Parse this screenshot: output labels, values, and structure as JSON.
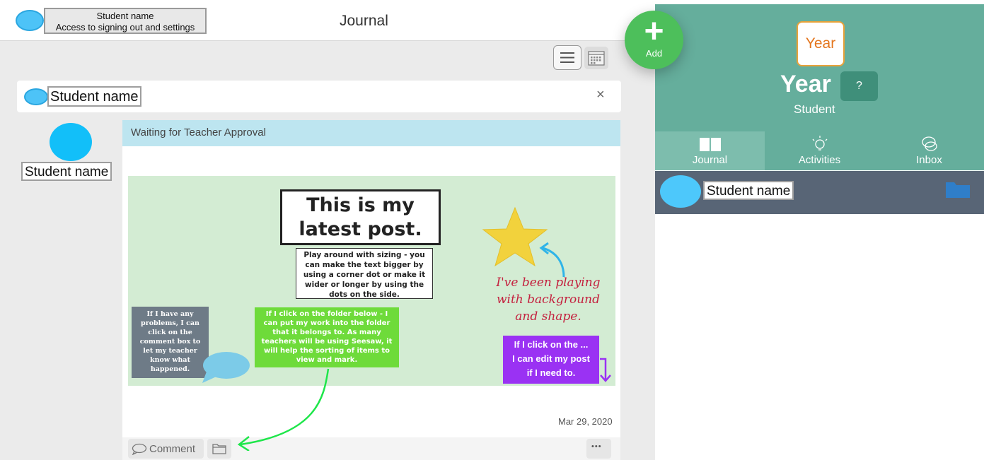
{
  "header": {
    "callout_line1": "Student name",
    "callout_line2": "Access to signing out and settings",
    "title": "Journal"
  },
  "filter": {
    "student_label": "Student name",
    "close_glyph": "×"
  },
  "post": {
    "author_label": "Student name",
    "status": "Waiting for Teacher Approval",
    "date": "Mar 29, 2020",
    "comment_label": "Comment",
    "more_glyph": "•••",
    "image": {
      "title_line1": "This is my",
      "title_line2": "latest post.",
      "sizing_tip": "Play around with sizing - you can make the text bigger by using a corner dot or make it wider or longer by using the dots on the side.",
      "comment_tip": "If I have any problems, I can click on the comment box to let my teacher know what happened.",
      "folder_tip": "If I click on the folder below - I can put my work into the folder that it belongs to. As many teachers will be using Seesaw, it will help the sorting of items to view and mark.",
      "background_note_line1": "I've been playing",
      "background_note_line2": "with background",
      "background_note_line3": "and shape.",
      "edit_tip_line1": "If I click on the ...",
      "edit_tip_line2": "I can edit my post",
      "edit_tip_line3": "if I need to."
    }
  },
  "add_button": {
    "label": "Add"
  },
  "profile": {
    "badge": "Year",
    "heading": "Year",
    "help": "?",
    "role": "Student"
  },
  "tabs": [
    {
      "label": "Journal"
    },
    {
      "label": "Activities"
    },
    {
      "label": "Inbox"
    }
  ],
  "student_row": {
    "label": "Student name"
  },
  "colors": {
    "teal": "#65ae9c",
    "add_green": "#4dbf5b",
    "approval_blue": "#bde5f0",
    "slate": "#586576",
    "poster_green": "#d3ecd3"
  },
  "icons": [
    "list-view-icon",
    "calendar-icon",
    "close-icon",
    "comment-icon",
    "folder-icon",
    "more-icon",
    "book-icon",
    "lightbulb-icon",
    "chat-bubbles-icon",
    "star-icon",
    "plus-icon"
  ]
}
